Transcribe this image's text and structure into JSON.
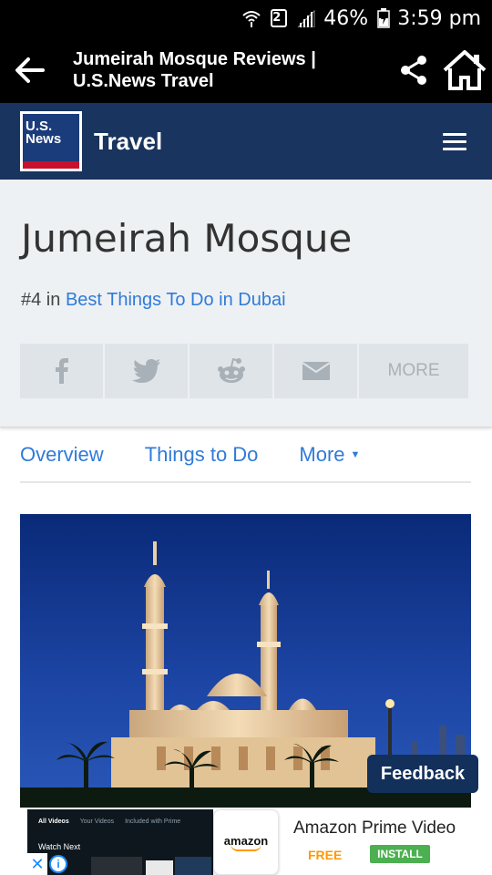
{
  "status_bar": {
    "sim_slot": "2",
    "battery": "46%",
    "time": "3:59 pm"
  },
  "app_bar": {
    "title": "Jumeirah Mosque Reviews | U.S.News Travel"
  },
  "site_header": {
    "logo_text_line1": "U.S.",
    "logo_text_line2": "News",
    "section_title": "Travel"
  },
  "hero": {
    "title": "Jumeirah Mosque",
    "rank_prefix": "#4 in ",
    "rank_link": "Best Things To Do in Dubai",
    "share_more_label": "MORE"
  },
  "tabs": [
    {
      "label": "Overview"
    },
    {
      "label": "Things to Do"
    },
    {
      "label": "More"
    }
  ],
  "feedback_label": "Feedback",
  "ad": {
    "thumb_tabs": [
      "All Videos",
      "Your Videos",
      "Included with Prime"
    ],
    "thumb_watch_next": "Watch Next",
    "logo_word": "amazon",
    "title": "Amazon Prime Video",
    "price": "FREE",
    "install_label": "INSTALL"
  },
  "colors": {
    "site_header_bg": "#19345e",
    "link": "#2f7bd9",
    "feedback_bg": "#13305b"
  }
}
